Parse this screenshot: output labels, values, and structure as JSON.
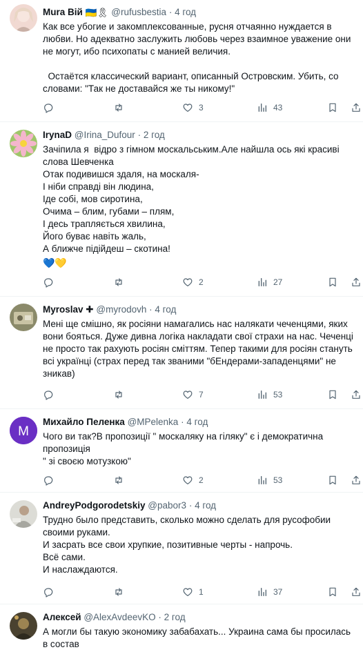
{
  "tweets": [
    {
      "name": "Mura Вій",
      "flags": "🇺🇦🎗",
      "handle": "@rufusbestia",
      "time": "4 год",
      "lines": [
        "Как все убогие и закомплексованные, русня отчаянно нуждается в",
        "любви. Но адекватно заслужить любовь через взаимное уважение они",
        "не могут, ибо психопаты с манией величия.",
        "",
        "  Остаётся классический вариант, описанный Островским. Убить, со",
        "словами: \"Так не доставайся же ты никому!\""
      ],
      "replies": "",
      "retweets": "",
      "likes": "3",
      "views": "43"
    },
    {
      "name": "IrynaD",
      "handle": "@Irina_Dufour",
      "time": "2 год",
      "lines": [
        "Зачіпила я  відро з гімном москальським.Але найшла ось які красиві",
        "слова Шевченка",
        "Отак подивишся здаля, на москаля-",
        "І ніби справді він людина,",
        "Іде собі, мов сиротина,",
        "Очима – блим, губами – плям,",
        "І десь трапляється хвилина,",
        "Його буває навіть жаль,",
        "А ближче підійдеш – скотина!"
      ],
      "hearts": "💙💛",
      "replies": "",
      "retweets": "",
      "likes": "2",
      "views": "27"
    },
    {
      "name": "Myroslav",
      "cross": "✚",
      "handle": "@myrodovh",
      "time": "4 год",
      "lines": [
        "Мені ще смішно, як росіяни намагались нас налякати чеченцями, яких",
        "вони бояться. Дуже дивна логіка накладати свої страхи на нас. Чеченці",
        "не просто так рахують росіян сміттям. Тепер такими для росіян стануть",
        "всі українці (страх перед так званими \"бЕндерами-западенцями\" не",
        "зникав)"
      ],
      "replies": "",
      "retweets": "",
      "likes": "7",
      "views": "53"
    },
    {
      "name": "Михайло Пеленка",
      "avatar_letter": "M",
      "handle": "@MPelenka",
      "time": "4 год",
      "lines": [
        "Чого ви так?В пропозиції \" москаляку на гіляку\" є і демократична",
        "пропозиція",
        "\" зі своєю мотузкою\""
      ],
      "replies": "",
      "retweets": "",
      "likes": "2",
      "views": "53"
    },
    {
      "name": "AndreyPodgorodetskiy",
      "handle": "@pabor3",
      "time": "4 год",
      "lines": [
        "Трудно было представить, сколько можно сделать для русофобии",
        "своими руками.",
        "И засрать все свои хрупкие, позитивные черты - напрочь.",
        "Всё сами.",
        "И наслаждаются."
      ],
      "replies": "",
      "retweets": "",
      "likes": "1",
      "views": "37"
    },
    {
      "name": "Алексей",
      "handle": "@AlexAvdeevKO",
      "time": "2 год",
      "lines": [
        "А могли бы такую экономику забабахать... Украина сама бы просилась",
        "в состав"
      ]
    }
  ],
  "colors": {
    "text": "#0f1419",
    "secondary": "#536471",
    "divider": "#eff3f4",
    "avatar_purple": "#6a2fc4"
  },
  "icons": {
    "reply": "reply-icon",
    "retweet": "retweet-icon",
    "like": "heart-icon",
    "views": "views-chart-icon",
    "bookmark": "bookmark-icon",
    "share": "share-icon"
  }
}
